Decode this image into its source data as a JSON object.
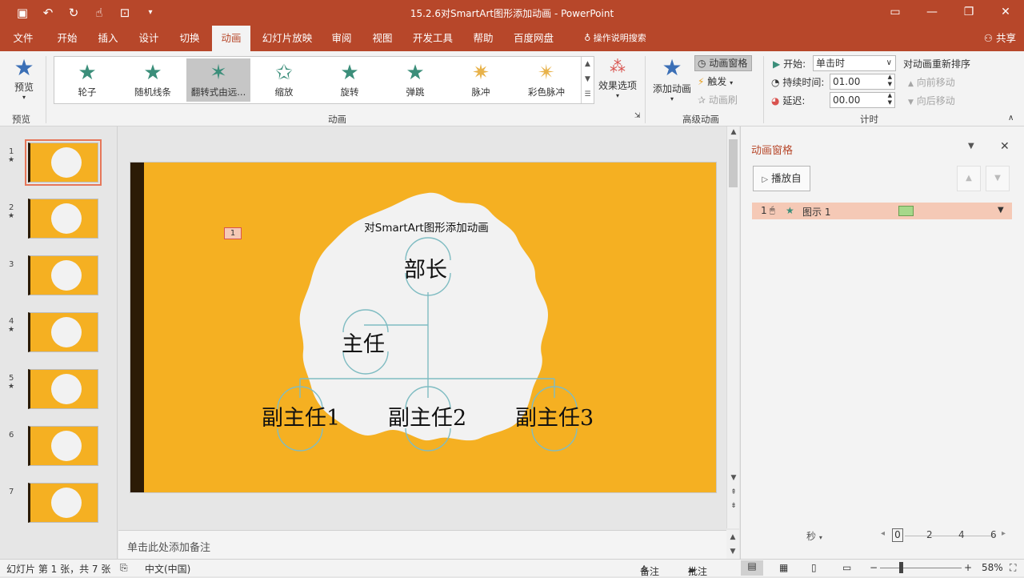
{
  "window": {
    "title": "15.2.6对SmartArt图形添加动画 - PowerPoint",
    "qat_icons": [
      "save-icon",
      "undo-icon",
      "redo-icon",
      "touch-mode-icon",
      "present-icon",
      "customize-icon"
    ],
    "controls": [
      "ribbon-display-icon",
      "minimize-icon",
      "restore-icon",
      "close-icon"
    ]
  },
  "tabs": [
    "文件",
    "开始",
    "插入",
    "设计",
    "切换",
    "动画",
    "幻灯片放映",
    "审阅",
    "视图",
    "开发工具",
    "帮助",
    "百度网盘"
  ],
  "active_tab": "动画",
  "tell_me": "操作说明搜索",
  "share": "共享",
  "ribbon": {
    "preview": {
      "label": "预览",
      "group": "预览"
    },
    "animations": [
      {
        "label": "轮子",
        "icon": "wheel-star-icon"
      },
      {
        "label": "随机线条",
        "icon": "random-bars-star-icon"
      },
      {
        "label": "翻转式由远...",
        "icon": "flip-star-icon"
      },
      {
        "label": "缩放",
        "icon": "zoom-star-icon"
      },
      {
        "label": "旋转",
        "icon": "swivel-star-icon"
      },
      {
        "label": "弹跳",
        "icon": "bounce-star-icon"
      },
      {
        "label": "脉冲",
        "icon": "pulse-star-icon"
      },
      {
        "label": "彩色脉冲",
        "icon": "color-pulse-star-icon"
      }
    ],
    "selected_animation": "翻转式由远...",
    "effect_options": "效果选项",
    "animation_group": "动画",
    "add_animation": "添加动画",
    "animation_pane_btn": "动画窗格",
    "trigger": "触发",
    "animation_painter": "动画刷",
    "advanced_group": "高级动画",
    "start_label": "开始:",
    "start_value": "单击时",
    "duration_label": "持续时间:",
    "duration_value": "01.00",
    "delay_label": "延迟:",
    "delay_value": "00.00",
    "timing_group": "计时",
    "reorder_title": "对动画重新排序",
    "move_earlier": "向前移动",
    "move_later": "向后移动"
  },
  "slides": [
    {
      "num": "1",
      "has_anim": true
    },
    {
      "num": "2",
      "has_anim": true
    },
    {
      "num": "3",
      "has_anim": false
    },
    {
      "num": "4",
      "has_anim": true
    },
    {
      "num": "5",
      "has_anim": true
    },
    {
      "num": "6",
      "has_anim": false
    },
    {
      "num": "7",
      "has_anim": false
    }
  ],
  "current_slide": {
    "anim_tag": "1",
    "smartart_title": "对SmartArt图形添加动画",
    "nodes": [
      "部长",
      "主任",
      "副主任1",
      "副主任2",
      "副主任3"
    ],
    "colors": {
      "background": "#f5b022",
      "bar": "#2c1b06",
      "cloud": "#f2f2f2",
      "connector": "#7fbcc2"
    }
  },
  "notes_placeholder": "单击此处添加备注",
  "pane": {
    "title": "动画窗格",
    "play_from": "播放自",
    "items": [
      {
        "num": "1",
        "name": "图示 1"
      }
    ],
    "timeline_unit": "秒",
    "timeline_ticks": [
      "0",
      "2",
      "4",
      "6"
    ]
  },
  "status": {
    "slide_info": "幻灯片 第 1 张，共 7 张",
    "language": "中文(中国)",
    "notes": "备注",
    "comments": "批注",
    "zoom": "58%"
  },
  "theme": {
    "accent": "#b7472a",
    "selection": "#f5c9b6"
  }
}
